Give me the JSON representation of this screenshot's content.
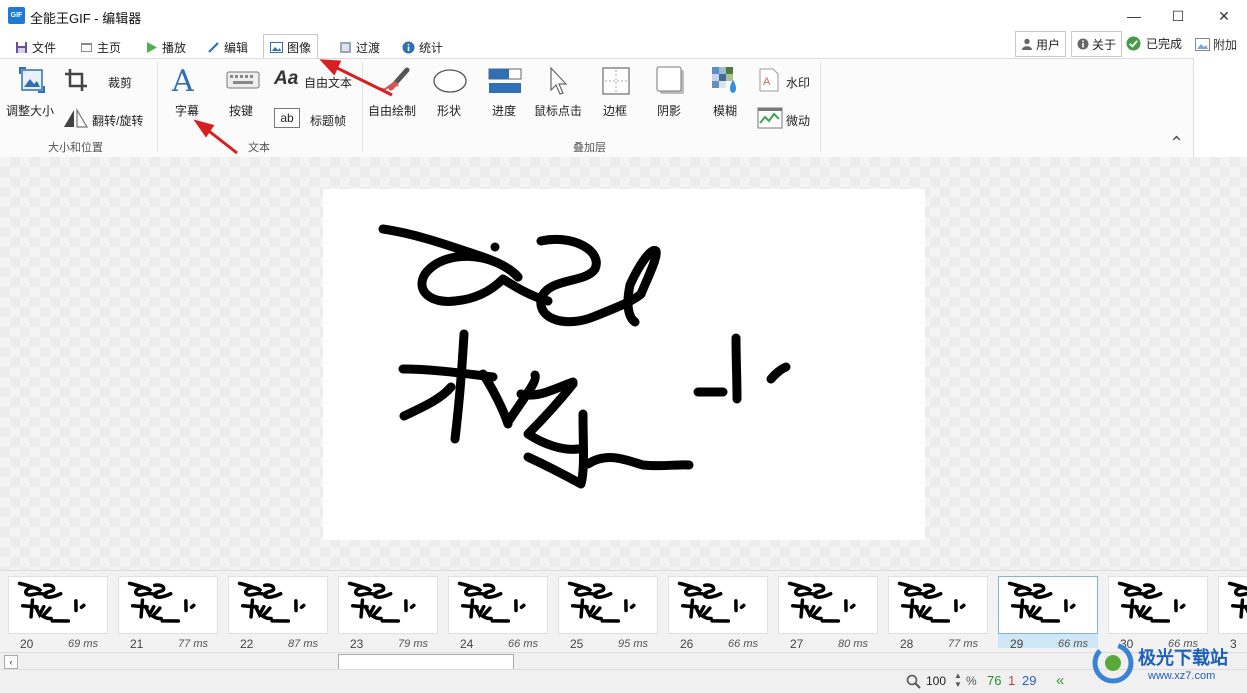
{
  "window": {
    "app_icon_text": "GIF",
    "title": "全能王GIF - 编辑器",
    "minimize_symbol": "—",
    "maximize_symbol": "☐",
    "close_symbol": "✕"
  },
  "tabs": [
    {
      "label": "文件",
      "icon": "save-icon"
    },
    {
      "label": "主页",
      "icon": "home-icon"
    },
    {
      "label": "播放",
      "icon": "play-icon"
    },
    {
      "label": "编辑",
      "icon": "pencil-icon"
    },
    {
      "label": "图像",
      "icon": "image-icon",
      "active": true
    },
    {
      "label": "过渡",
      "icon": "transition-icon"
    },
    {
      "label": "统计",
      "icon": "info-icon"
    }
  ],
  "right_buttons": {
    "user": "用户",
    "about": "关于",
    "done": "已完成",
    "extra": "附加"
  },
  "ribbon": {
    "groups": {
      "size_position": "大小和位置",
      "text": "文本",
      "overlay": "叠加层"
    },
    "size_position": {
      "resize": "调整大小",
      "crop": "裁剪",
      "flip_rotate": "翻转/旋转"
    },
    "text": {
      "caption": "字幕",
      "keystrokes": "按键",
      "free_text": "自由文本",
      "title_frame": "标题帧",
      "aa_glyph": "Aa",
      "ab_glyph": "ab"
    },
    "overlay": {
      "free_drawing": "自由绘制",
      "shapes": "形状",
      "progress": "进度",
      "mouse_clicks": "鼠标点击",
      "border": "边框",
      "shadow": "阴影",
      "blur": "模糊",
      "watermark": "水印",
      "cinemagraph": "微动"
    },
    "collapse_symbol": "⌃"
  },
  "frames": [
    {
      "index": "20",
      "delay": "69 ms"
    },
    {
      "index": "21",
      "delay": "77 ms"
    },
    {
      "index": "22",
      "delay": "87 ms"
    },
    {
      "index": "23",
      "delay": "79 ms"
    },
    {
      "index": "24",
      "delay": "66 ms"
    },
    {
      "index": "25",
      "delay": "95 ms"
    },
    {
      "index": "26",
      "delay": "66 ms"
    },
    {
      "index": "27",
      "delay": "80 ms"
    },
    {
      "index": "28",
      "delay": "77 ms"
    },
    {
      "index": "29",
      "delay": "66 ms",
      "selected": true
    },
    {
      "index": "30",
      "delay": "66 ms"
    },
    {
      "index": "3",
      "delay": ""
    }
  ],
  "status": {
    "zoom": "100",
    "zoom_unit": "%",
    "frame_count_total": "76",
    "frame_count_selected": "1",
    "frame_current": "29"
  },
  "watermark": {
    "text": "极光下载站",
    "url": "www.xz7.com"
  },
  "colors": {
    "accent_blue": "#1e7ad6",
    "selected_frame": "#cfe6f7",
    "count_green": "#2e8b2e",
    "count_red": "#d23a3a",
    "count_blue": "#2a5fb8",
    "arrow_red": "#d62020"
  }
}
